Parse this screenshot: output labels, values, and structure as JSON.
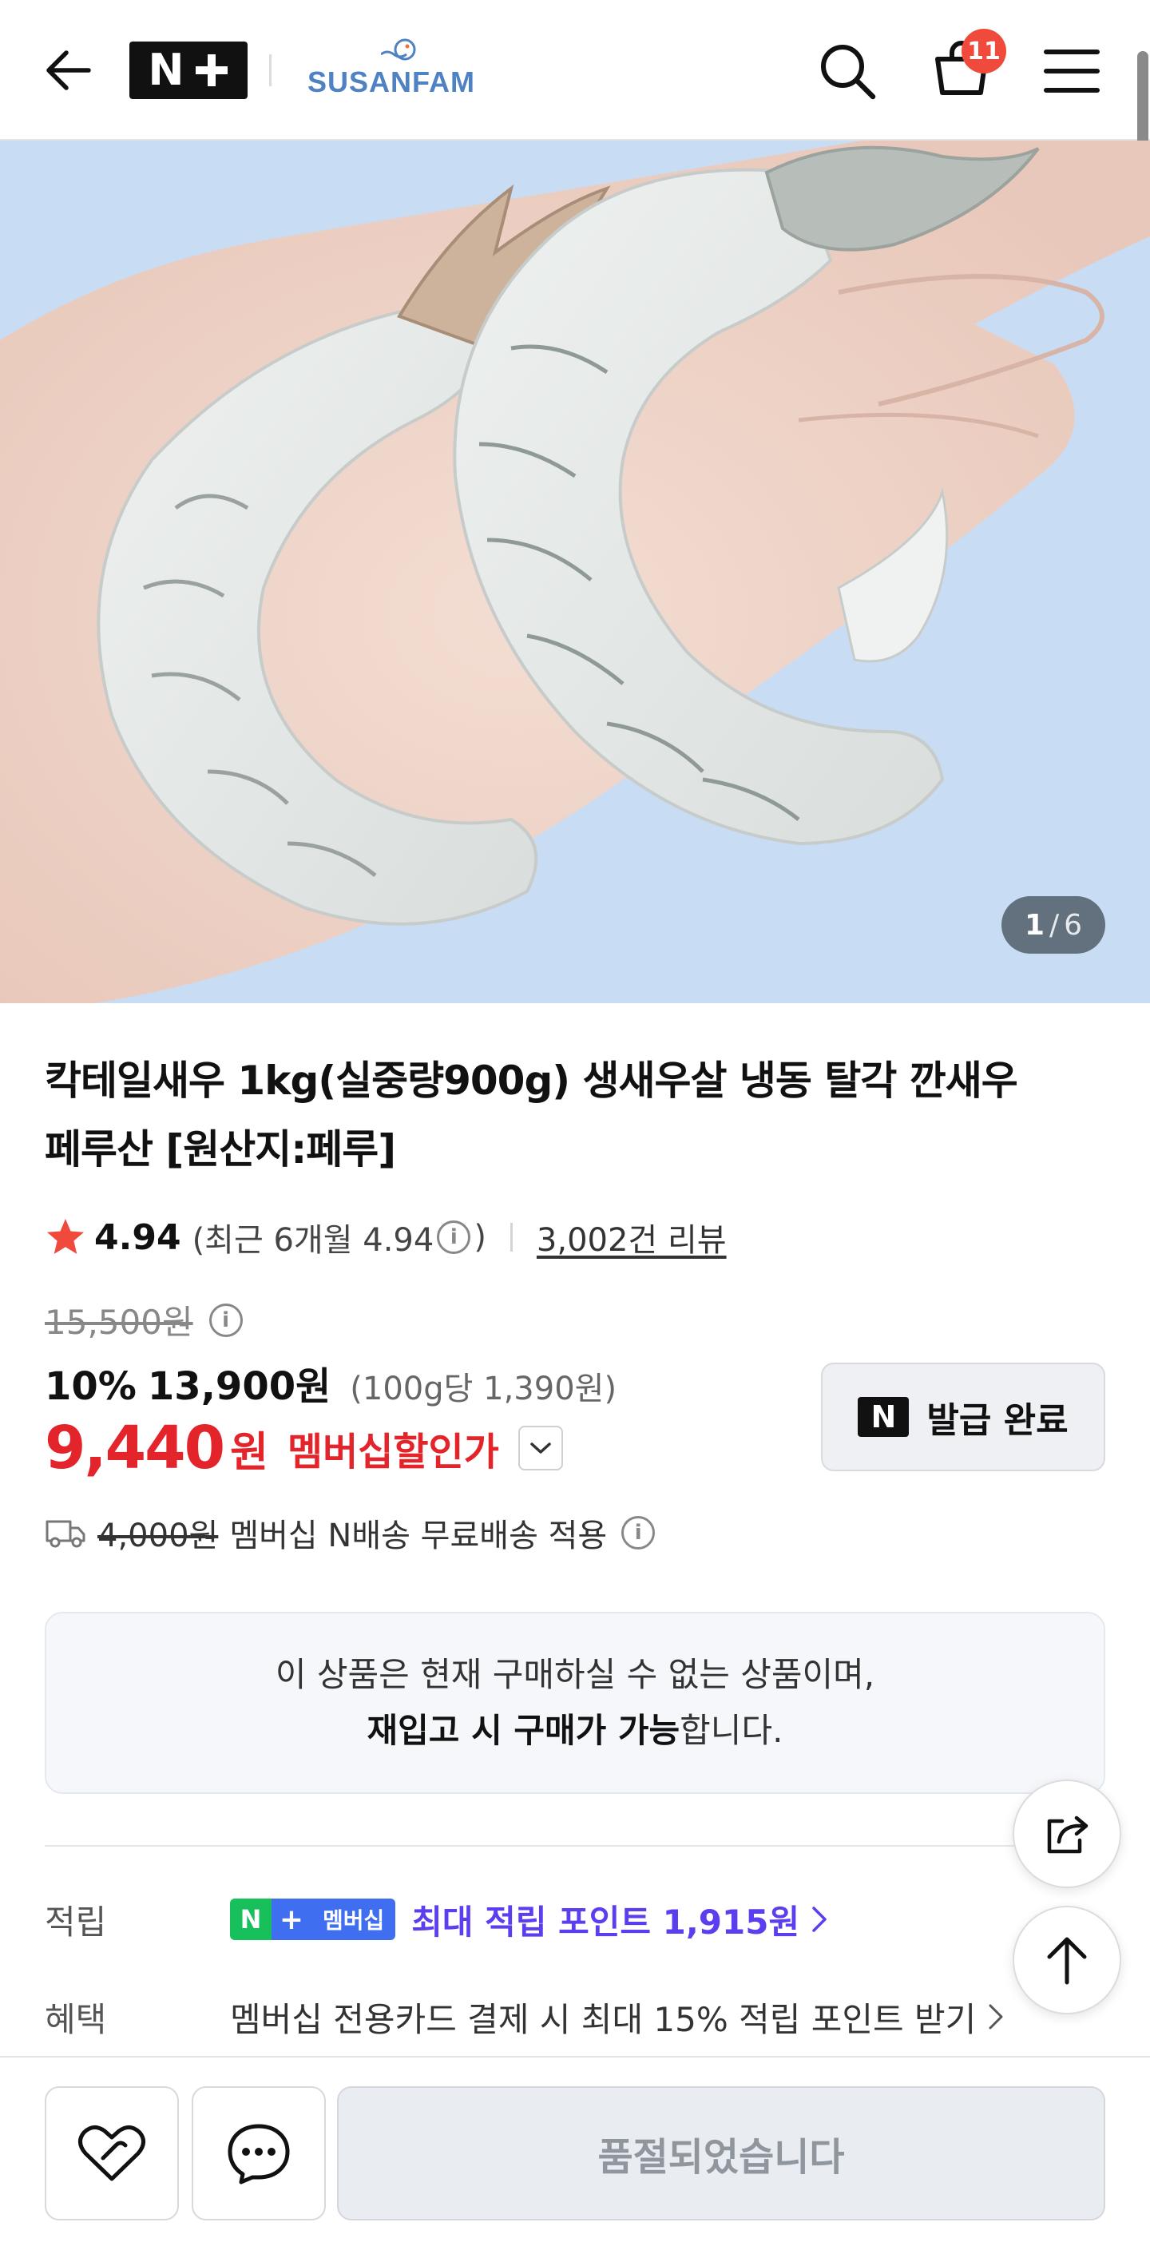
{
  "header": {
    "cart_count": "11",
    "brand_name": "SUSANFAM",
    "nplus_logo_text": "N+"
  },
  "product_image": {
    "current": "1",
    "separator": "/",
    "total": "6"
  },
  "product": {
    "title_line1": "칵테일새우 1kg(실중량900g) 생새우살 냉동 탈각 깐새우",
    "title_line2": "페루산 [원산지:페루]",
    "rating": "4.94",
    "recent_rating": "(최근 6개월 4.94",
    "recent_rating_close": ")",
    "review_count": "3,002건 리뷰",
    "original_price": "15,500원",
    "discount_rate": "10%",
    "sale_price": "13,900원",
    "unit_price": "(100g당 1,390원)",
    "member_price": "9,440",
    "member_price_unit": "원",
    "member_price_label": "멤버십할인가",
    "coupon_label": "발급 완료",
    "coupon_n": "N",
    "delivery_old_fee": "4,000원",
    "delivery_text": "멤버십 N배송 무료배송 적용"
  },
  "notice": {
    "line1": "이 상품은 현재 구매하실 수 없는 상품이며,",
    "line2_bold": "재입고 시 구매가 가능",
    "line2_rest": "합니다."
  },
  "points": {
    "label": "적립",
    "badge_n": "N",
    "badge_plus": "+",
    "badge_text": "멤버십",
    "text": "최대 적립 포인트 1,915원"
  },
  "benefit": {
    "label": "혜택",
    "text": "멤버십 전용카드 결제 시 최대 15% 적립 포인트 받기"
  },
  "bottom_bar": {
    "soldout_label": "품절되었습니다"
  },
  "colors": {
    "accent_red": "#e3242b",
    "points_purple": "#5c3df0",
    "badge_green": "#17c05b",
    "badge_blue": "#3f6ef0",
    "cart_badge": "#f04a3c",
    "image_bg": "#c8dcf4",
    "brand_blue": "#4f82c2"
  },
  "icons": [
    "back-arrow-icon",
    "search-icon",
    "cart-icon",
    "menu-icon",
    "star-icon",
    "info-icon",
    "chevron-down-icon",
    "delivery-truck-icon",
    "chevron-right-icon",
    "share-icon",
    "arrow-up-icon",
    "heart-icon",
    "chat-icon"
  ]
}
